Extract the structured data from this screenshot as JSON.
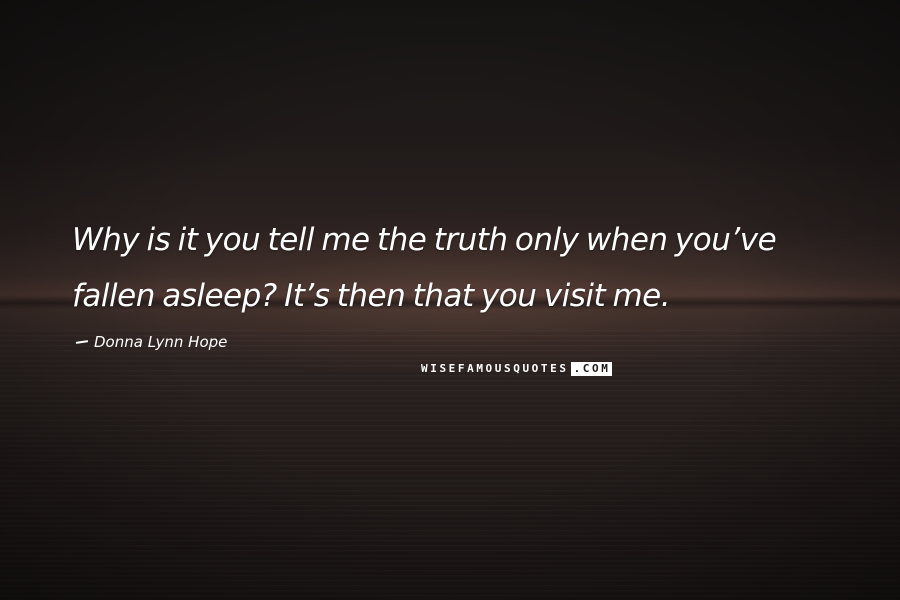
{
  "quote": {
    "line1": "Why is it you tell me the truth only when you’ve",
    "line2": "fallen asleep? It’s then that you visit me."
  },
  "author": {
    "name": "Donna Lynn Hope"
  },
  "watermark": {
    "left": "WISEFAMOUSQUOTES",
    "right": ".COM"
  },
  "colors": {
    "text": "#ffffff",
    "background": "#1c1716",
    "horizon_glow": "#4a3530"
  }
}
